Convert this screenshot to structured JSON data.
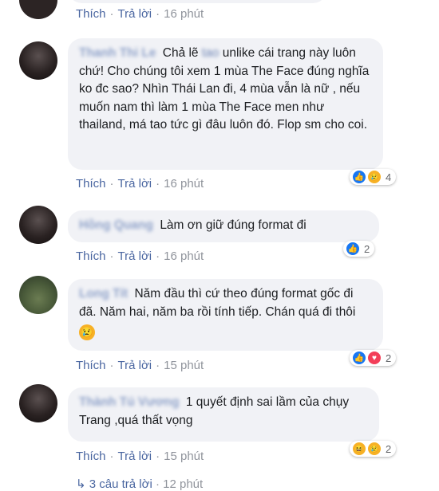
{
  "labels": {
    "like": "Thích",
    "reply": "Trả lời",
    "sep": "·"
  },
  "comments": [
    {
      "time": "16 phút"
    },
    {
      "author": "Thanh Thi Le",
      "text_blur": "tao",
      "text_pre": "Chả lẽ",
      "text": "unlike cái trang này luôn chứ! Cho chúng tôi xem 1 mùa The Face đúng nghĩa ko đc sao? Nhìn Thái Lan đi, 4 mùa vẫn là nữ , nếu muốn nam thì làm 1 mùa The Face men như thailand, má tao tức gì đâu luôn đó. Flop sm cho coi.",
      "time": "16 phút",
      "reaction_count": "4"
    },
    {
      "author": "Hồng Quang",
      "text": "Làm ơn giữ đúng format đi",
      "time": "16 phút",
      "reaction_count": "2"
    },
    {
      "author": "Long Tít",
      "text": "Năm đầu thì cứ theo đúng format gốc đi đã. Năm hai, năm ba rồi tính tiếp. Chán quá đi thôi",
      "emoji": "😢",
      "time": "15 phút",
      "reaction_count": "2"
    },
    {
      "author": "Thành Tú Vương",
      "text": "1 quyết định sai lầm của chụy Trang ,quá thất vọng",
      "time": "15 phút",
      "reaction_count": "2"
    }
  ],
  "more_replies": {
    "label": "3 câu trả lời",
    "time": "12 phút"
  },
  "colors": {
    "bubble": "#f1f2f6",
    "link": "#4b67a1",
    "muted": "#90949c"
  },
  "icons": [
    "like-icon",
    "love-icon",
    "haha-icon",
    "sad-icon",
    "reply-arrow-icon"
  ]
}
